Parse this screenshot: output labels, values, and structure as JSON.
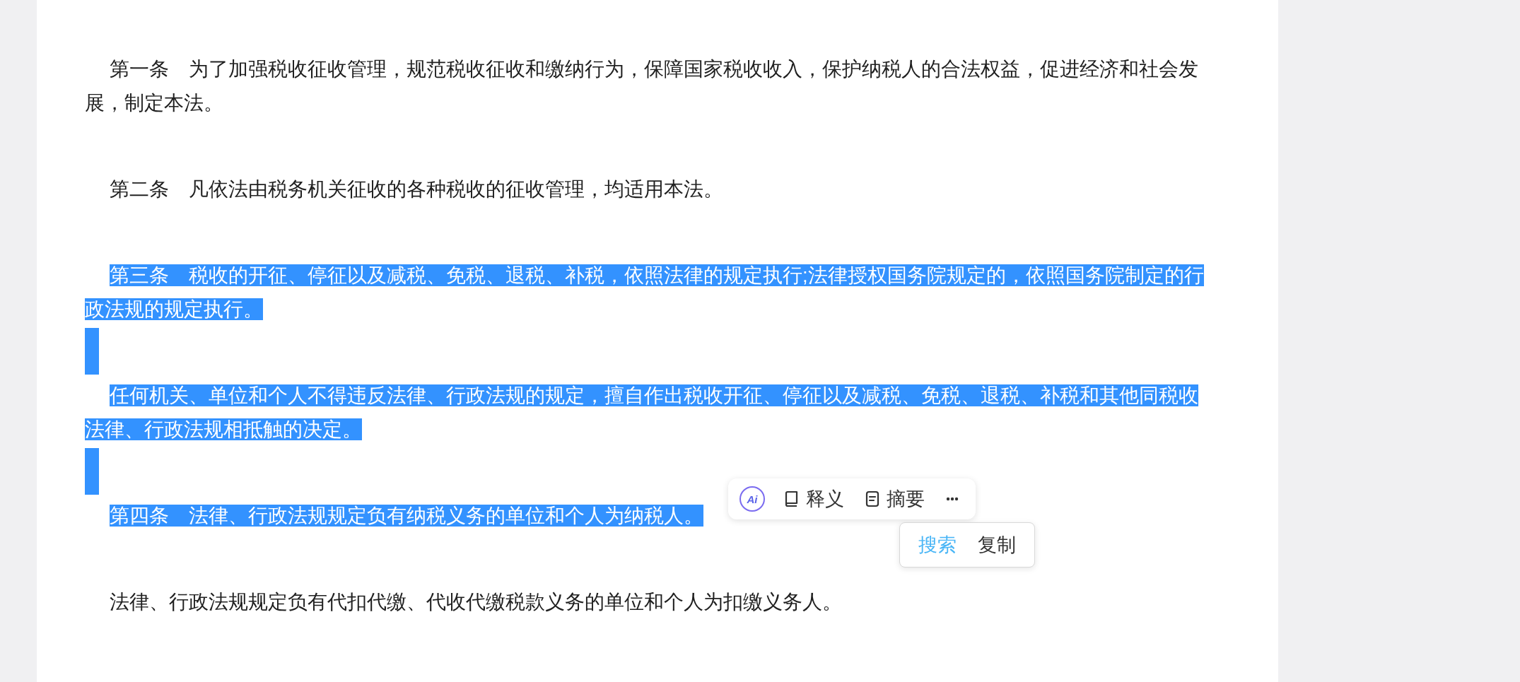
{
  "document": {
    "paragraphs": [
      {
        "kind": "text",
        "text": "第一条　为了加强税收征收管理，规范税收征收和缴纳行为，保障国家税收收入，保护纳税人的合法权益，促进经济和社会发展，制定本法。",
        "selected": false
      },
      {
        "kind": "text",
        "text": "第二条　凡依法由税务机关征收的各种税收的征收管理，均适用本法。",
        "selected": false
      },
      {
        "kind": "text",
        "text": "第三条　税收的开征、停征以及减税、免税、退税、补税，依照法律的规定执行;法律授权国务院规定的，依照国务院制定的行政法规的规定执行。",
        "selected": true
      },
      {
        "kind": "blank",
        "selected": true
      },
      {
        "kind": "text",
        "text": "任何机关、单位和个人不得违反法律、行政法规的规定，擅自作出税收开征、停征以及减税、免税、退税、补税和其他同税收法律、行政法规相抵触的决定。",
        "selected": true
      },
      {
        "kind": "blank",
        "selected": true
      },
      {
        "kind": "text",
        "text": "第四条　法律、行政法规规定负有纳税义务的单位和个人为纳税人。",
        "selected": true
      },
      {
        "kind": "text",
        "text": "法律、行政法规规定负有代扣代缴、代收代缴税款义务的单位和个人为扣缴义务人。",
        "selected": false
      }
    ]
  },
  "selection_toolbar": {
    "items": [
      {
        "kind": "ai",
        "label": "Ai"
      },
      {
        "kind": "book",
        "label": "释义"
      },
      {
        "kind": "note",
        "label": "摘要"
      },
      {
        "kind": "more"
      }
    ]
  },
  "context_menu": {
    "items": [
      {
        "label": "搜索",
        "selected": true
      },
      {
        "label": "复制",
        "selected": false
      }
    ]
  }
}
